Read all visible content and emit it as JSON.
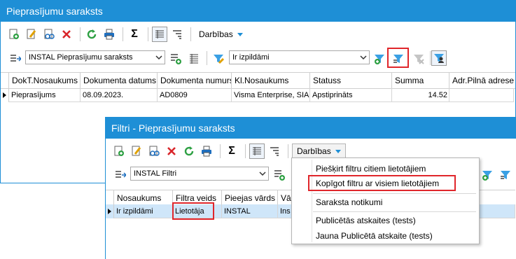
{
  "main_window": {
    "title": "Pieprasījumu saraksts",
    "toolbar": {
      "actions_label": "Darbības"
    },
    "list_select": "INSTAL Pieprasījumu saraksts",
    "filter_select": "Ir izpildāmi",
    "columns": [
      "DokT.Nosaukums",
      "Dokumenta datums",
      "Dokumenta numurs",
      "Kl.Nosaukums",
      "Statuss",
      "Summa",
      "Adr.Pilnā adrese"
    ],
    "rows": [
      [
        "Pieprasījums",
        "08.09.2023.",
        "AD0809",
        "Visma Enterprise, SIA",
        "Apstiprināts",
        "14.52",
        ""
      ]
    ]
  },
  "filter_window": {
    "title": "Filtri - Pieprasījumu saraksts",
    "toolbar": {
      "actions_label": "Darbības"
    },
    "list_select": "INSTAL Filtri",
    "columns": [
      "Nosaukums",
      "Filtra veids",
      "Pieejas vārds",
      "Vā"
    ],
    "rows": [
      [
        "Ir izpildāmi",
        "Lietotāja",
        "INSTAL",
        "Ins"
      ]
    ]
  },
  "actions_menu": {
    "items": [
      "Piešķirt filtru citiem lietotājiem",
      "Kopīgot filtru ar visiem lietotājiem",
      "Saraksta notikumi",
      "Publicētās atskaites (tests)",
      "Jauna Publicētā atskaite (tests)"
    ]
  },
  "colors": {
    "titlebar": "#1e8fd6",
    "highlight": "#e0262b",
    "selected_row": "#cfe6f9"
  }
}
